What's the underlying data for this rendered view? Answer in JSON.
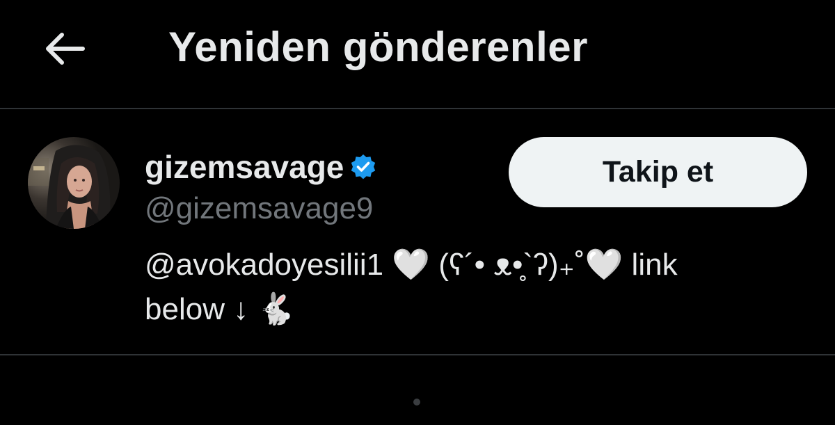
{
  "header": {
    "title": "Yeniden gönderenler",
    "back_icon": "arrow-left-icon"
  },
  "user": {
    "display_name": "gizemsavage",
    "verified_icon": "verified-badge-icon",
    "handle": "@gizemsavage9",
    "follow_label": "Takip et",
    "bio": {
      "mention": "@avokadoyesilii1",
      "line1_rest": "🤍 (ʕ´• ᴥ•̥`ʔ)₊˚🤍 link",
      "line2": "below ↓ 🐇"
    }
  },
  "colors": {
    "background": "#000000",
    "text": "#e7e9ea",
    "secondary_text": "#71767b",
    "divider": "#2f3336",
    "verified_blue": "#1d9bf0",
    "follow_button_bg": "#eff3f4",
    "follow_button_text": "#0f1419"
  }
}
